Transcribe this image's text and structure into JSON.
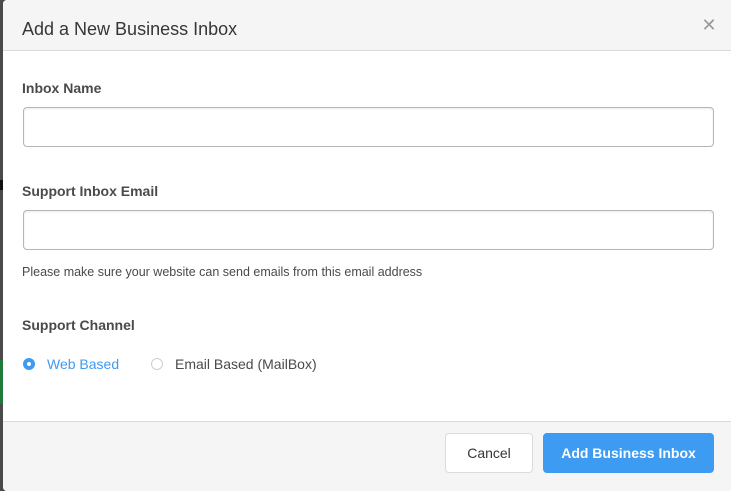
{
  "modal": {
    "title": "Add a New Business Inbox",
    "close_icon": "close-icon"
  },
  "form": {
    "inbox_name": {
      "label": "Inbox Name",
      "value": "",
      "placeholder": ""
    },
    "support_email": {
      "label": "Support Inbox Email",
      "value": "",
      "placeholder": "",
      "help": "Please make sure your website can send emails from this email address"
    },
    "support_channel": {
      "label": "Support Channel",
      "options": [
        {
          "label": "Web Based",
          "selected": true
        },
        {
          "label": "Email Based (MailBox)",
          "selected": false
        }
      ]
    }
  },
  "footer": {
    "cancel_label": "Cancel",
    "submit_label": "Add Business Inbox"
  },
  "colors": {
    "accent": "#3e9bf2",
    "header_bg": "#f5f5f5",
    "text": "#4a4a4a"
  }
}
